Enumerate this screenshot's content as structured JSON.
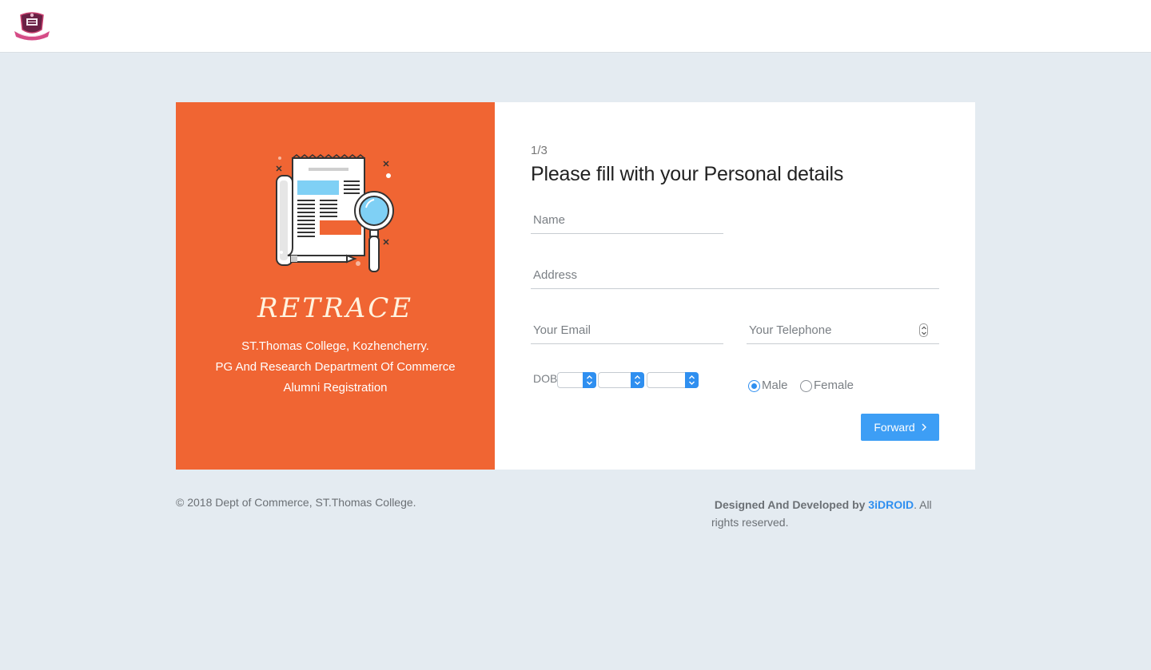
{
  "header": {
    "logo_name": "college-crest-logo"
  },
  "branding": {
    "name": "RETRACE",
    "college": "ST.Thomas College, Kozhencherry.",
    "department": "PG And Research Department Of Commerce",
    "purpose": "Alumni Registration",
    "accent_color": "#f06533"
  },
  "form": {
    "step": "1/3",
    "title": "Please fill with your Personal details",
    "name_placeholder": "Name",
    "address_placeholder": "Address",
    "email_placeholder": "Your Email",
    "telephone_placeholder": "Your Telephone",
    "dob_label": "DOB",
    "dob_day": "",
    "dob_month": "",
    "dob_year": "",
    "gender_options": [
      "Male",
      "Female"
    ],
    "gender_selected": "Male",
    "forward_label": "Forward",
    "button_color": "#3d9ef5"
  },
  "footer": {
    "copyright": "© 2018 Dept of Commerce, ST.Thomas College.",
    "designed_prefix": "Designed And Developed by",
    "developer": "3iDROID",
    "rights": ". All rights reserved."
  }
}
